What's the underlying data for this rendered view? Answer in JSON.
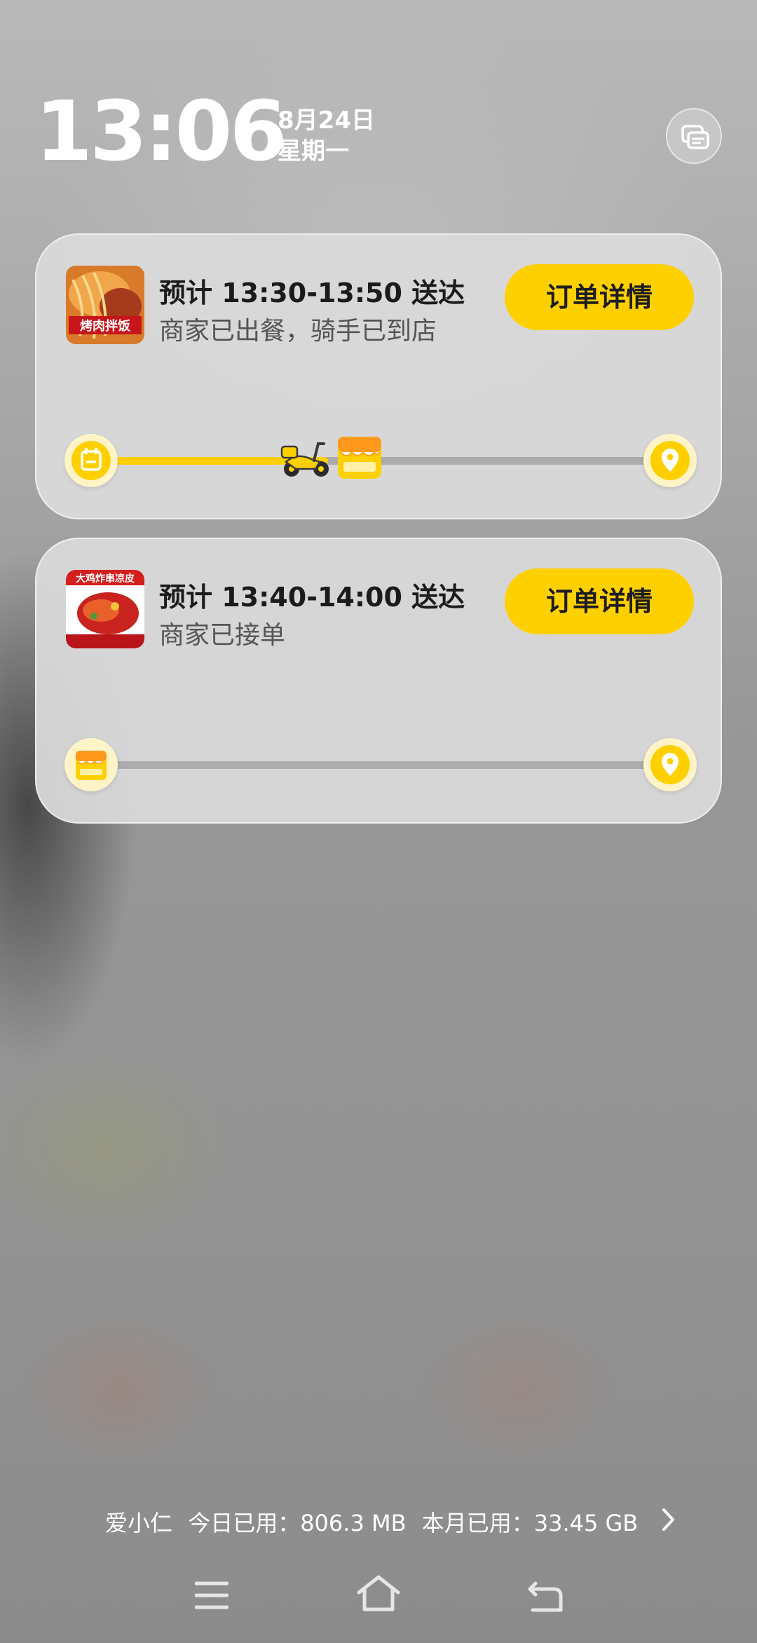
{
  "lockscreen": {
    "time": "13:06",
    "date": "8月24日",
    "weekday": "星期一"
  },
  "notifications": [
    {
      "eta": "预计 13:30-13:50 送达",
      "status": "商家已出餐，骑手已到店",
      "button_label": "订单详情",
      "progress": 0.38,
      "thumb_text": "烤肉拌饭"
    },
    {
      "eta": "预计 13:40-14:00 送达",
      "status": "商家已接单",
      "button_label": "订单详情",
      "progress": 0.0,
      "thumb_text": "大鸡炸串凉皮"
    }
  ],
  "data_usage": {
    "user": "爱小仁",
    "today": "今日已用：806.3 MB",
    "month": "本月已用：33.45 GB"
  },
  "colors": {
    "accent": "#ffd000",
    "track": "#acacac",
    "card_bg": "#dadada"
  },
  "icons": {
    "cards_button": "notification-cards-icon",
    "start_node": "calendar-icon",
    "merchant_node": "shop-icon",
    "rider": "scooter-icon",
    "destination": "location-pin-icon",
    "nav_menu": "menu-icon",
    "nav_home": "home-icon",
    "nav_back": "back-icon"
  }
}
